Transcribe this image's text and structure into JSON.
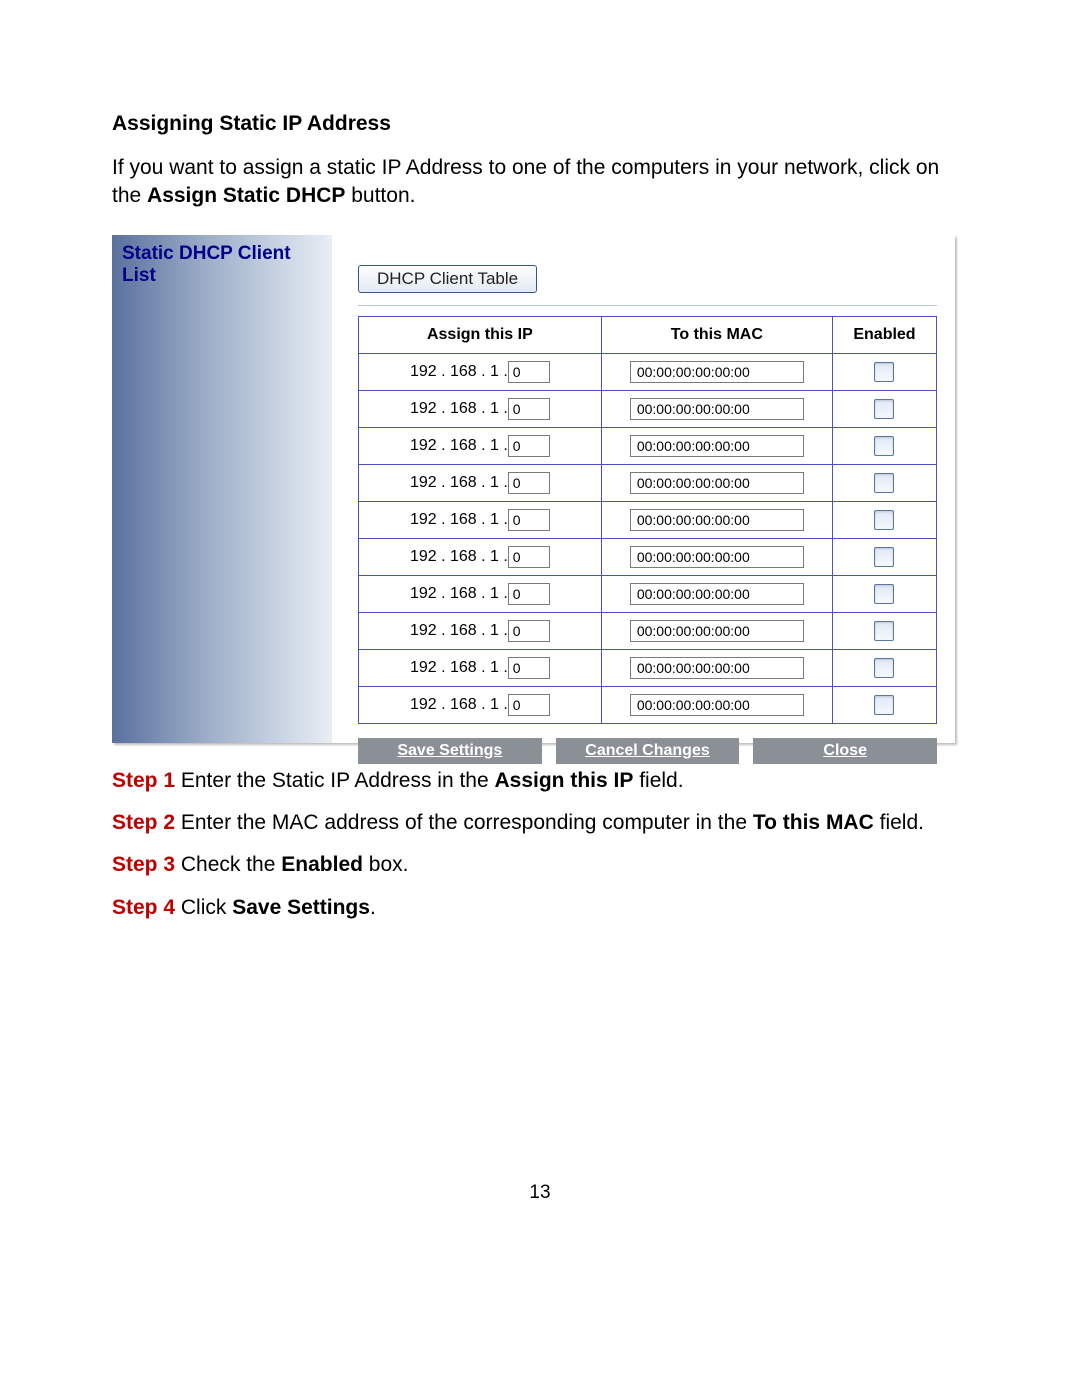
{
  "heading": "Assigning Static IP Address",
  "intro": {
    "pre": "If you want to assign a static IP Address to one of the computers in your network, click on the ",
    "bold": "Assign Static DHCP",
    "post": " button."
  },
  "panel": {
    "title": "Static DHCP Client List",
    "dhcp_button": "DHCP Client Table",
    "columns": {
      "ip": "Assign this IP",
      "mac": "To this MAC",
      "enabled": "Enabled"
    },
    "ip_prefix": "192 . 168 . 1 . ",
    "rows": [
      {
        "ip_last": "0",
        "mac": "00:00:00:00:00:00",
        "enabled": false
      },
      {
        "ip_last": "0",
        "mac": "00:00:00:00:00:00",
        "enabled": false
      },
      {
        "ip_last": "0",
        "mac": "00:00:00:00:00:00",
        "enabled": false
      },
      {
        "ip_last": "0",
        "mac": "00:00:00:00:00:00",
        "enabled": false
      },
      {
        "ip_last": "0",
        "mac": "00:00:00:00:00:00",
        "enabled": false
      },
      {
        "ip_last": "0",
        "mac": "00:00:00:00:00:00",
        "enabled": false
      },
      {
        "ip_last": "0",
        "mac": "00:00:00:00:00:00",
        "enabled": false
      },
      {
        "ip_last": "0",
        "mac": "00:00:00:00:00:00",
        "enabled": false
      },
      {
        "ip_last": "0",
        "mac": "00:00:00:00:00:00",
        "enabled": false
      },
      {
        "ip_last": "0",
        "mac": "00:00:00:00:00:00",
        "enabled": false
      }
    ],
    "buttons": {
      "save": "Save Settings",
      "cancel": "Cancel Changes",
      "close": "Close"
    }
  },
  "steps": [
    {
      "label": "Step 1",
      "pre": " Enter the Static IP Address in the ",
      "bold": "Assign this IP",
      "post": " field."
    },
    {
      "label": "Step 2",
      "pre": " Enter the MAC address of the corresponding computer in the ",
      "bold": "To this MAC",
      "post": " field."
    },
    {
      "label": "Step 3",
      "pre": " Check the ",
      "bold": "Enabled",
      "post": " box."
    },
    {
      "label": "Step 4",
      "pre": " Click ",
      "bold": "Save Settings",
      "post": "."
    }
  ],
  "page_number": "13"
}
